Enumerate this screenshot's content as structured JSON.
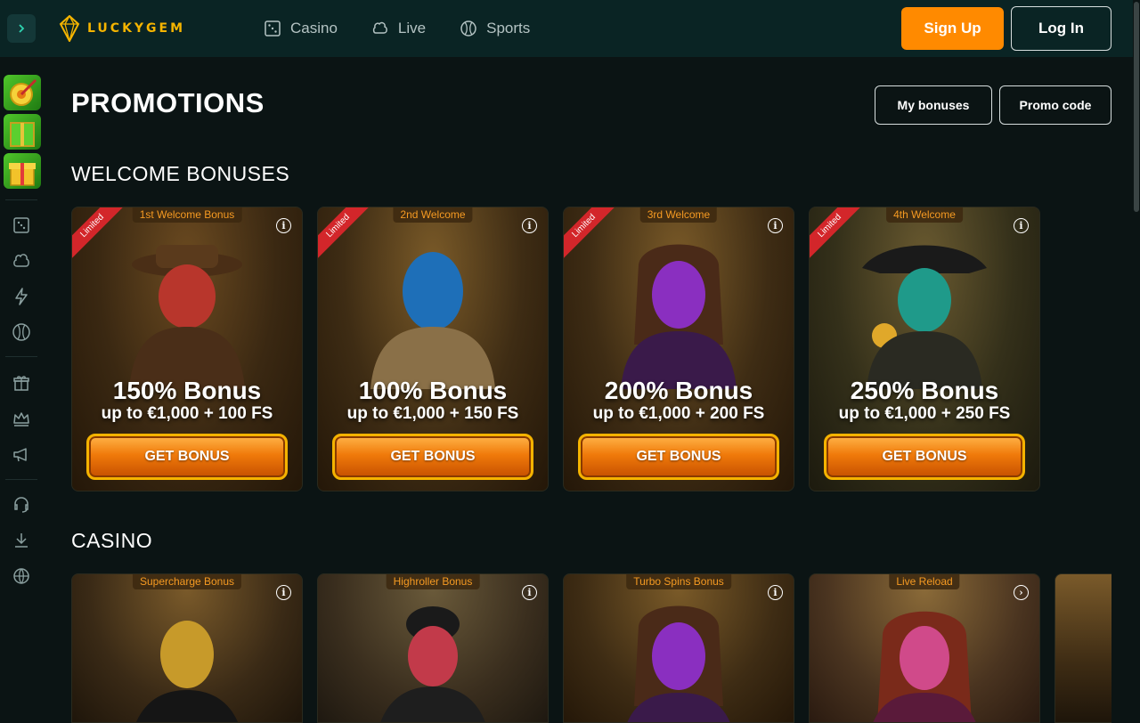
{
  "header": {
    "brand": "LUCKYGEM",
    "nav": [
      {
        "label": "Casino",
        "icon": "dice-icon"
      },
      {
        "label": "Live",
        "icon": "chip-icon"
      },
      {
        "label": "Sports",
        "icon": "ball-icon"
      }
    ],
    "signup_label": "Sign Up",
    "login_label": "Log In"
  },
  "page": {
    "title": "PROMOTIONS",
    "my_bonuses_label": "My bonuses",
    "promo_code_label": "Promo code"
  },
  "welcome": {
    "section_title": "WELCOME BONUSES",
    "cards": [
      {
        "tag": "1st Welcome Bonus",
        "ribbon": "Limited",
        "headline": "150% Bonus",
        "subline": "up to €1,000 + 100 FS",
        "button": "GET BONUS",
        "accent": "#b8362c"
      },
      {
        "tag": "2nd Welcome",
        "ribbon": "Limited",
        "headline": "100% Bonus",
        "subline": "up to €1,000 + 150 FS",
        "button": "GET BONUS",
        "accent": "#1e6fb8"
      },
      {
        "tag": "3rd Welcome",
        "ribbon": "Limited",
        "headline": "200% Bonus",
        "subline": "up to €1,000 + 200 FS",
        "button": "GET BONUS",
        "accent": "#8a2fc0"
      },
      {
        "tag": "4th Welcome",
        "ribbon": "Limited",
        "headline": "250% Bonus",
        "subline": "up to €1,000 + 250 FS",
        "button": "GET BONUS",
        "accent": "#1f9a8a"
      }
    ]
  },
  "casino": {
    "section_title": "CASINO",
    "cards": [
      {
        "tag": "Supercharge Bonus",
        "accent": "#c79a2a"
      },
      {
        "tag": "Highroller Bonus",
        "accent": "#c23a4a"
      },
      {
        "tag": "Turbo Spins Bonus",
        "accent": "#8a2fc0"
      },
      {
        "tag": "Live Reload",
        "accent": "#d04a8a"
      }
    ]
  },
  "colors": {
    "brand": "#f5b400",
    "signup": "#ff8a00",
    "header_bg": "#0a2424",
    "page_bg": "#0b1414"
  }
}
